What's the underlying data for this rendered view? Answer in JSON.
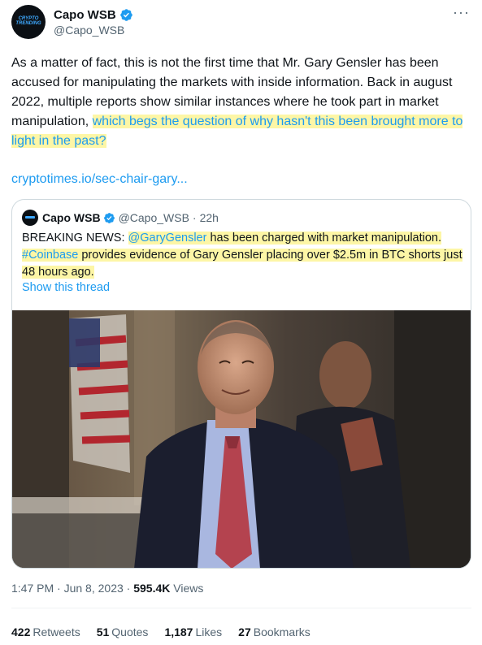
{
  "author": {
    "display_name": "Capo WSB",
    "handle": "@Capo_WSB",
    "avatar_text": "CRYPTO TRENDING",
    "verified_color": "#1d9bf0"
  },
  "tweet": {
    "text_plain": "As a matter of fact, this is not the first time that Mr. Gary Gensler has been accused for manipulating the markets with inside information. Back in august 2022, multiple reports show similar instances where he took part in market manipulation, ",
    "text_highlight": "which begs the question of why hasn't this been brought more to light in the past?",
    "link": "cryptotimes.io/sec-chair-gary..."
  },
  "quote": {
    "display_name": "Capo WSB",
    "handle": "@Capo_WSB",
    "separator": "·",
    "time": "22h",
    "text_part1": "BREAKING NEWS: ",
    "mention": "@GaryGensler",
    "text_part2": " has been charged with market manipulation.",
    "hashtag": "#Coinbase",
    "text_part3": " provides evidence of Gary Gensler placing over $2.5m in BTC shorts just 48 hours ago.",
    "show_thread": "Show this thread"
  },
  "meta": {
    "time": "1:47 PM",
    "date": "Jun 8, 2023",
    "views_count": "595.4K",
    "views_label": "Views",
    "separator": "·"
  },
  "stats": {
    "retweets_count": "422",
    "retweets_label": "Retweets",
    "quotes_count": "51",
    "quotes_label": "Quotes",
    "likes_count": "1,187",
    "likes_label": "Likes",
    "bookmarks_count": "27",
    "bookmarks_label": "Bookmarks"
  },
  "colors": {
    "link": "#1d9bf0",
    "highlight": "#fdf6a6",
    "secondary_text": "#536471"
  }
}
